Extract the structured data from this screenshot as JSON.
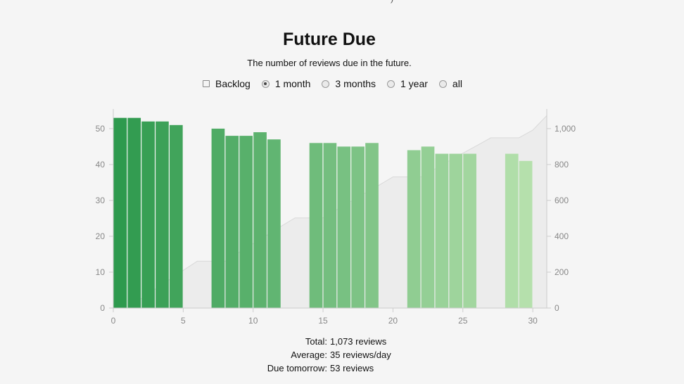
{
  "header": {
    "fragment": ")",
    "title": "Future Due",
    "subtitle": "The number of reviews due in the future."
  },
  "controls": {
    "backlog_label": "Backlog",
    "options": [
      "1 month",
      "3 months",
      "1 year",
      "all"
    ],
    "selected": "1 month"
  },
  "chart_data": {
    "type": "bar",
    "x": [
      1,
      2,
      3,
      4,
      5,
      8,
      9,
      10,
      11,
      12,
      15,
      16,
      17,
      18,
      19,
      22,
      23,
      24,
      25,
      26,
      29,
      30
    ],
    "values": [
      53,
      53,
      52,
      52,
      51,
      50,
      48,
      48,
      49,
      47,
      46,
      46,
      45,
      45,
      46,
      44,
      45,
      43,
      43,
      43,
      43,
      41
    ],
    "cumulative_area": {
      "x": [
        0,
        1,
        2,
        3,
        4,
        5,
        6,
        7,
        8,
        9,
        10,
        11,
        12,
        13,
        14,
        15,
        16,
        17,
        18,
        19,
        20,
        21,
        22,
        23,
        24,
        25,
        26,
        27,
        28,
        29,
        30,
        31
      ],
      "y": [
        0,
        0,
        53,
        106,
        158,
        210,
        261,
        261,
        261,
        311,
        359,
        407,
        456,
        503,
        503,
        503,
        549,
        595,
        640,
        685,
        731,
        731,
        731,
        775,
        820,
        863,
        906,
        949,
        949,
        949,
        992,
        1073
      ]
    },
    "xlim": [
      0,
      31
    ],
    "x_ticks": [
      "0",
      "5",
      "10",
      "15",
      "20",
      "25",
      "30"
    ],
    "ylim_left": [
      0,
      55
    ],
    "y_ticks_left": [
      "0",
      "10",
      "20",
      "30",
      "40",
      "50"
    ],
    "ylim_right": [
      0,
      1100
    ],
    "y_ticks_right": [
      "0",
      "200",
      "400",
      "600",
      "800",
      "1,000"
    ],
    "colors": {
      "bar_dark": "#2e9a4e",
      "bar_light": "#b5e0ac",
      "area": "#999999",
      "axis": "#cccccc"
    }
  },
  "stats": [
    {
      "label": "Total:",
      "value": "1,073 reviews"
    },
    {
      "label": "Average:",
      "value": "35 reviews/day"
    },
    {
      "label": "Due tomorrow:",
      "value": "53 reviews"
    }
  ]
}
